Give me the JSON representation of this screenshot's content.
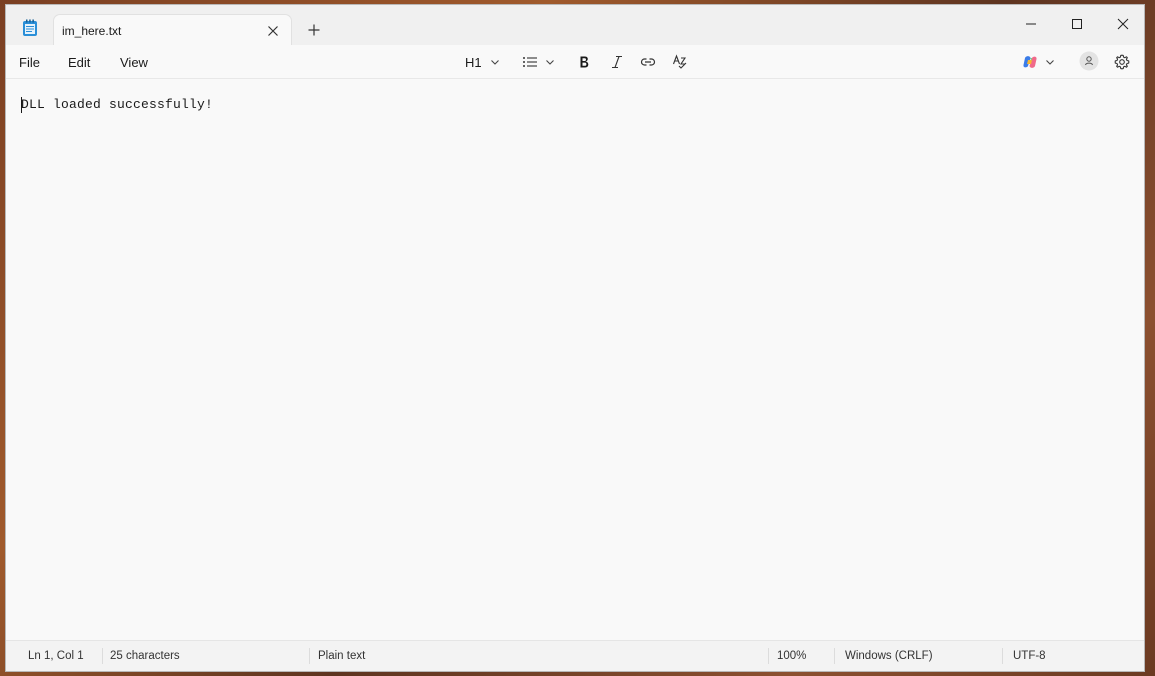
{
  "tab": {
    "title": "im_here.txt"
  },
  "menu": {
    "file": "File",
    "edit": "Edit",
    "view": "View"
  },
  "toolbar": {
    "heading": "H1"
  },
  "editor": {
    "content": "DLL loaded successfully!"
  },
  "status": {
    "position": "Ln 1, Col 1",
    "characters": "25 characters",
    "format": "Plain text",
    "zoom": "100%",
    "line_ending": "Windows (CRLF)",
    "encoding": "UTF-8"
  },
  "colors": {
    "accent": "#1a1a1a",
    "app_icon": "#2a8fd8"
  },
  "icons": [
    "notepad-icon",
    "close-icon",
    "plus-icon",
    "minimize-icon",
    "maximize-icon",
    "window-close-icon",
    "chevron-down-icon",
    "list-icon",
    "bold-icon",
    "italic-icon",
    "link-icon",
    "spellcheck-icon",
    "copilot-icon",
    "account-icon",
    "gear-icon"
  ]
}
